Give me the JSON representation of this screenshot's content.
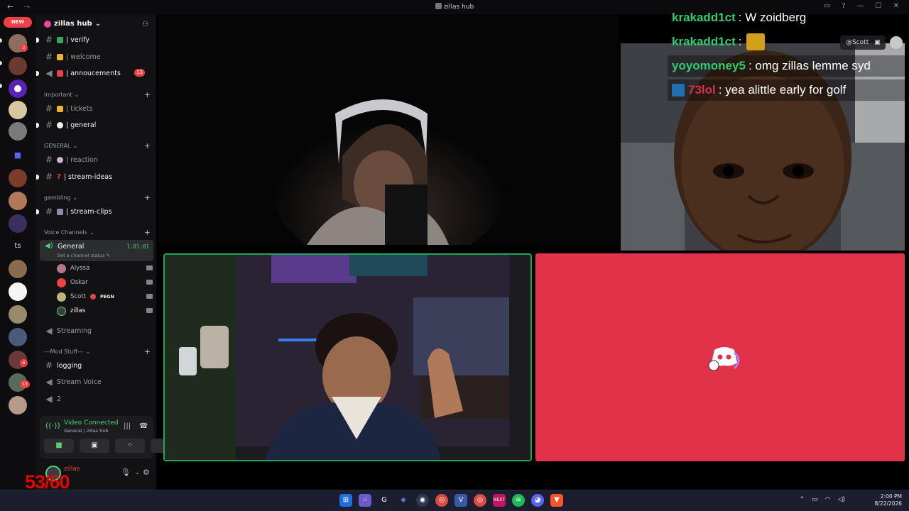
{
  "window": {
    "title": "zillas hub",
    "nav_back": "←",
    "nav_forward": "→",
    "controls": [
      "▭",
      "?",
      "—",
      "☐",
      "✕"
    ]
  },
  "rail": {
    "new_badge": "NEW",
    "server_badges": [
      "2",
      "6",
      "13"
    ],
    "ts_label": "ts"
  },
  "sidebar": {
    "server_name": "zillas hub",
    "server_caret": "⌄",
    "channels_top": [
      {
        "label": "| verify"
      },
      {
        "label": "| welcome"
      },
      {
        "label": "| annoucements",
        "badge": "13"
      }
    ],
    "categories": {
      "important": "Important",
      "general": "GENERAL",
      "gambling": "gambling",
      "voice": "Voice Channels",
      "mod": "---Mod Stuff---"
    },
    "important_channels": [
      {
        "label": "| tickets"
      },
      {
        "label": "| general"
      }
    ],
    "general_channels": [
      {
        "label": "| reaction"
      },
      {
        "label": "| stream-ideas"
      }
    ],
    "gambling_channels": [
      {
        "label": "| stream-clips"
      }
    ],
    "voice": {
      "name": "General",
      "time": "1:01:01",
      "status": "Set a channel status ✎",
      "members": [
        {
          "name": "Alyssa"
        },
        {
          "name": "Oskar"
        },
        {
          "name": "Scott",
          "tag": "PEGN"
        },
        {
          "name": "zillas"
        }
      ],
      "streaming": "Streaming"
    },
    "mod_channels": [
      {
        "label": "logging"
      },
      {
        "label": "Stream Voice"
      },
      {
        "label": "2"
      }
    ]
  },
  "connection": {
    "title": "Video Connected",
    "subtitle": "General / zillas hub"
  },
  "user": {
    "name": "zillas"
  },
  "overlay": {
    "fps": "53/60",
    "scott_tag": "@Scott"
  },
  "chat": [
    {
      "name": "krakadd1ct",
      "message": ": W zoidberg",
      "color": "#2ecc71"
    },
    {
      "name": "krakadd1ct",
      "message": ":",
      "color": "#2ecc71"
    },
    {
      "name": "yoyomoney5",
      "message": ": omg zillas lemme syd",
      "color": "#2ecc71"
    },
    {
      "name": "73lol",
      "message": ": yea alittle early for golf",
      "color": "#d9304b"
    }
  ],
  "taskbar": {
    "time": "2:00 PM",
    "date": "8/22/2026"
  },
  "colors": {
    "accent_green": "#23a55a",
    "red_tile": "#e0334a",
    "mention_red": "#f23f43"
  }
}
